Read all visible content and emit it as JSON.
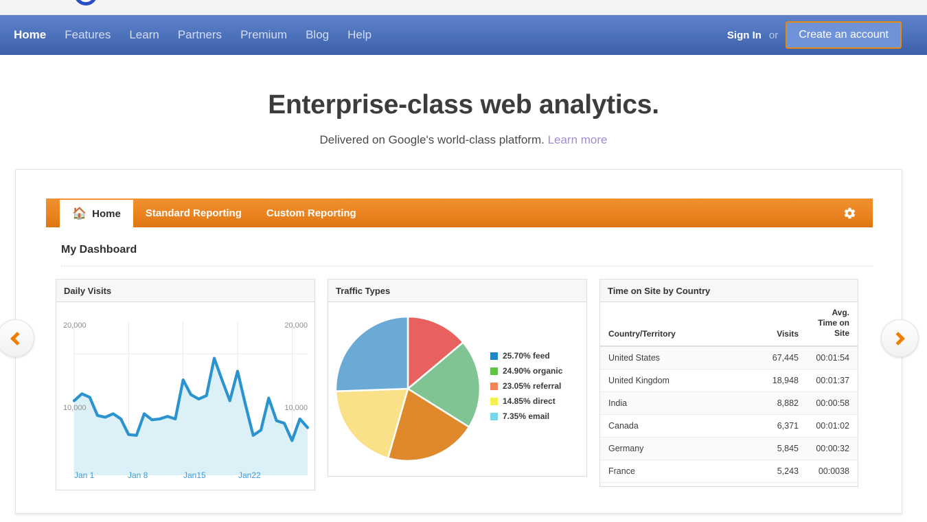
{
  "brand": {
    "logo_icon": "circle-logo-icon",
    "nav_bg_top": "#5e82c8",
    "nav_bg_bottom": "#3c5fa8",
    "accent_orange": "#e8890c"
  },
  "nav": {
    "links": [
      {
        "label": "Home",
        "active": true
      },
      {
        "label": "Features",
        "active": false
      },
      {
        "label": "Learn",
        "active": false
      },
      {
        "label": "Partners",
        "active": false
      },
      {
        "label": "Premium",
        "active": false
      },
      {
        "label": "Blog",
        "active": false
      },
      {
        "label": "Help",
        "active": false
      }
    ],
    "sign_in": "Sign In",
    "or": "or",
    "create_account": "Create an account"
  },
  "hero": {
    "title": "Enterprise-class web analytics.",
    "subtitle": "Delivered on Google's world-class platform.",
    "link": "Learn more"
  },
  "carousel": {
    "prev_icon": "chevron-left-icon",
    "next_icon": "chevron-right-icon"
  },
  "app": {
    "tabs": [
      {
        "label": "Home",
        "icon": "home-icon",
        "active": true
      },
      {
        "label": "Standard Reporting",
        "active": false
      },
      {
        "label": "Custom Reporting",
        "active": false
      }
    ],
    "settings_icon": "gear-icon",
    "dashboard_title": "My Dashboard"
  },
  "widgets": {
    "daily_visits": {
      "title": "Daily Visits"
    },
    "traffic_types": {
      "title": "Traffic Types"
    },
    "time_on_site": {
      "title": "Time on Site by Country"
    }
  },
  "table": {
    "columns": [
      "Country/Territory",
      "Visits",
      "Avg. Time on Site"
    ],
    "column_avgtime_lines": [
      "Avg.",
      "Time on",
      "Site"
    ],
    "rows": [
      {
        "country": "United States",
        "visits": "67,445",
        "avg_time": "00:01:54"
      },
      {
        "country": "United Kingdom",
        "visits": "18,948",
        "avg_time": "00:01:37"
      },
      {
        "country": "India",
        "visits": "8,882",
        "avg_time": "00:00:58"
      },
      {
        "country": "Canada",
        "visits": "6,371",
        "avg_time": "00:01:02"
      },
      {
        "country": "Germany",
        "visits": "5,845",
        "avg_time": "00:00:32"
      },
      {
        "country": "France",
        "visits": "5,243",
        "avg_time": "00:0038"
      }
    ]
  },
  "chart_data": [
    {
      "type": "line",
      "title": "Daily Visits",
      "xlabel": "",
      "ylabel": "",
      "ylim": [
        6000,
        22000
      ],
      "grid": true,
      "line_color": "#2b93ce",
      "area_color": "#dcf0f8",
      "y_ticks": [
        "20,000",
        "10,000"
      ],
      "y_ticks_right": [
        "20,000",
        "10,000"
      ],
      "x_ticks": [
        "Jan 1",
        "Jan 8",
        "Jan15",
        "Jan22"
      ],
      "x": [
        1,
        2,
        3,
        4,
        5,
        6,
        7,
        8,
        9,
        10,
        11,
        12,
        13,
        14,
        15,
        16,
        17,
        18,
        19,
        20,
        21,
        22,
        23,
        24,
        25,
        26,
        27,
        28,
        29,
        30,
        31
      ],
      "values": [
        14600,
        15400,
        15000,
        12900,
        12700,
        13100,
        12500,
        10700,
        10600,
        13100,
        12400,
        12500,
        12800,
        12500,
        17000,
        15300,
        14800,
        15200,
        19500,
        17000,
        14600,
        18000,
        14200,
        10600,
        11200,
        14900,
        12300,
        12000,
        10000,
        12500,
        11500
      ]
    },
    {
      "type": "pie",
      "title": "Traffic Types",
      "legend_position": "right",
      "categories": [
        "feed",
        "organic",
        "referral",
        "direct",
        "email"
      ],
      "values": [
        25.7,
        24.9,
        23.05,
        14.85,
        7.35
      ],
      "labels": [
        "25.70% feed",
        "24.90% organic",
        "23.05% referral",
        "14.85% direct",
        "7.35% email"
      ],
      "legend_colors": [
        "#1f87c8",
        "#63c244",
        "#f0845a",
        "#f2f24f",
        "#76d6ea"
      ],
      "slice_colors": [
        "#6aaad4",
        "#e8615e",
        "#7fc492",
        "#e0882c",
        "#fbe08a"
      ],
      "slice_order": [
        "feed",
        "referral",
        "organic",
        "direct",
        "email"
      ]
    }
  ]
}
